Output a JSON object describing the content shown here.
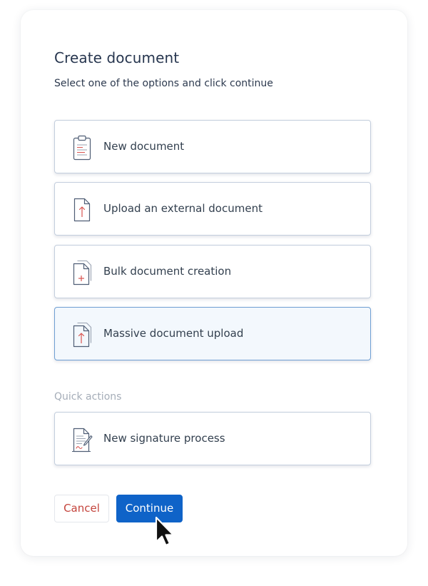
{
  "dialog": {
    "title": "Create document",
    "subtitle": "Select one of the options and click continue"
  },
  "options": [
    {
      "label": "New document",
      "icon": "clipboard-document-icon",
      "selected": false
    },
    {
      "label": "Upload an external document",
      "icon": "upload-document-icon",
      "selected": false
    },
    {
      "label": "Bulk document creation",
      "icon": "bulk-document-plus-icon",
      "selected": false
    },
    {
      "label": "Massive document upload",
      "icon": "multiple-upload-document-icon",
      "selected": true
    }
  ],
  "quick_actions": {
    "label": "Quick actions",
    "items": [
      {
        "label": "New signature process",
        "icon": "signature-document-icon"
      }
    ]
  },
  "actions": {
    "cancel_label": "Cancel",
    "continue_label": "Continue"
  },
  "colors": {
    "primary": "#0f63c8",
    "cancel_text": "#c4443c",
    "selected_background": "#f3f8fd",
    "selected_border": "#6f9fd3",
    "icon_stroke": "#4f5e75",
    "icon_accent": "#d9534f"
  }
}
